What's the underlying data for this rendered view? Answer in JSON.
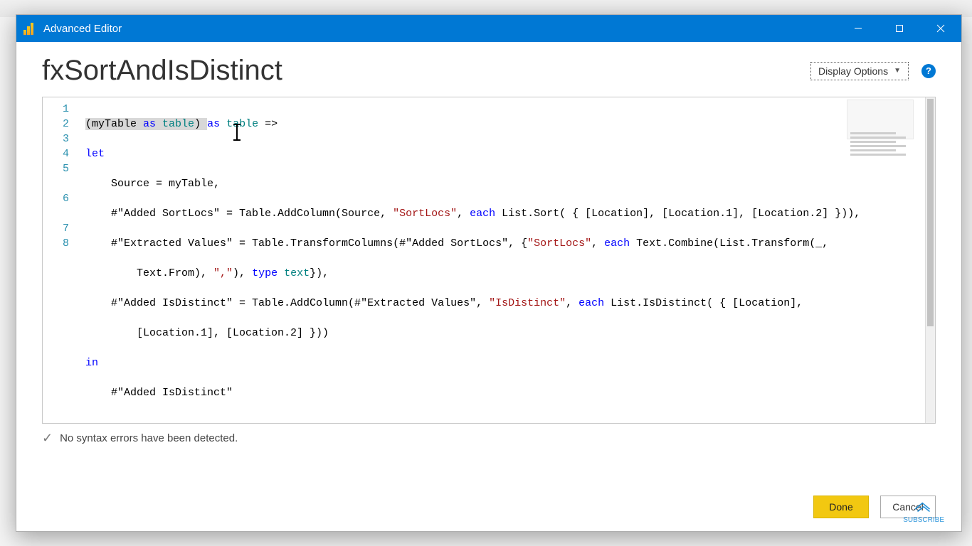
{
  "window": {
    "title": "Advanced Editor"
  },
  "header": {
    "query_name": "fxSortAndIsDistinct",
    "display_options_label": "Display Options",
    "help_tooltip": "Help"
  },
  "editor": {
    "line_numbers": [
      "1",
      "2",
      "3",
      "4",
      "5",
      "6",
      "7",
      "8"
    ],
    "code": {
      "l1": {
        "a": "(myTable ",
        "kw1": "as",
        "b": " ",
        "ty1": "table",
        "c": ") ",
        "kw2": "as",
        "d": " ",
        "ty2": "table",
        "e": " =>"
      },
      "l2": {
        "kw": "let"
      },
      "l3": {
        "a": "    Source = myTable,"
      },
      "l4": {
        "a": "    #\"Added SortLocs\" = Table.AddColumn(Source, ",
        "s": "\"SortLocs\"",
        "b": ", ",
        "kw": "each",
        "c": " List.Sort( { [Location], [Location.1], [Location.2] })),"
      },
      "l5": {
        "a": "    #\"Extracted Values\" = Table.TransformColumns(#\"Added SortLocs\", {",
        "s": "\"SortLocs\"",
        "b": ", ",
        "kw": "each",
        "c": " Text.Combine(List.Transform(_,"
      },
      "l5b": {
        "a": "        Text.From), ",
        "s": "\",\"",
        "b": "), ",
        "kw": "type",
        "c": " ",
        "ty": "text",
        "d": "}),"
      },
      "l6": {
        "a": "    #\"Added IsDistinct\" = Table.AddColumn(#\"Extracted Values\", ",
        "s": "\"IsDistinct\"",
        "b": ", ",
        "kw": "each",
        "c": " List.IsDistinct( { [Location],"
      },
      "l6b": {
        "a": "        [Location.1], [Location.2] }))"
      },
      "l7": {
        "kw": "in"
      },
      "l8": {
        "a": "    #\"Added IsDistinct\""
      }
    }
  },
  "status": {
    "message": "No syntax errors have been detected."
  },
  "buttons": {
    "done": "Done",
    "cancel": "Cancel"
  },
  "overlay": {
    "subscribe": "SUBSCRIBE"
  }
}
